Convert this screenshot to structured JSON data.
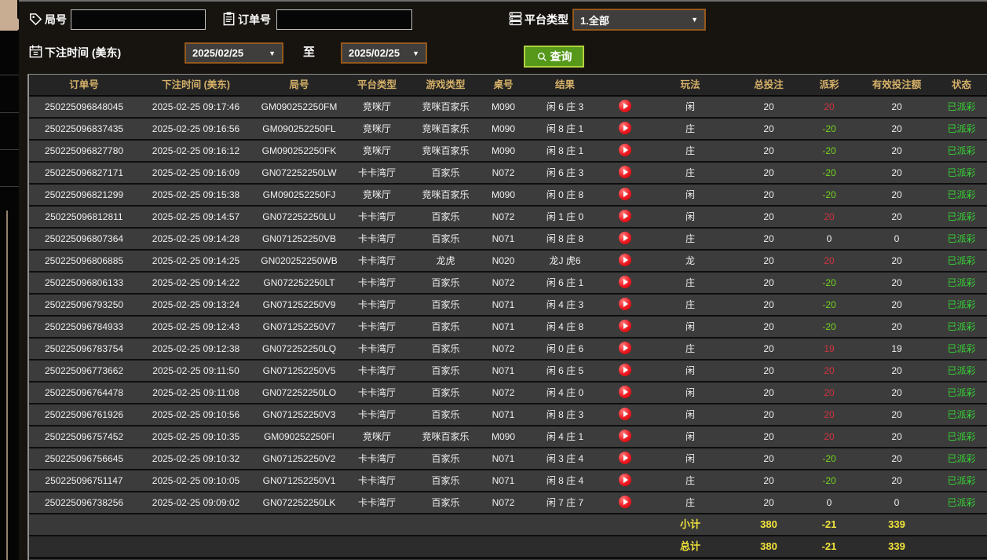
{
  "filters": {
    "round_label": "局号",
    "round_value": "",
    "order_label": "订单号",
    "order_value": "",
    "platform_label": "平台类型",
    "platform_value": "1.全部",
    "bet_time_label": "下注时间 (美东)",
    "date_from": "2025/02/25",
    "date_to": "2025/02/25",
    "to_label": "至",
    "query_label": "查询"
  },
  "colors": {
    "accent_gold": "#d5b169",
    "query_button_green": "#55981a",
    "query_button_border": "#b3d13e",
    "select_border_orange": "#94581d",
    "payout_positive_red": "#cf3440",
    "payout_negative_green": "#72d41f",
    "status_green": "#35d435",
    "summary_yellow": "#f2e33c",
    "tab_tan": "#c9ad92"
  },
  "table": {
    "columns": [
      "订单号",
      "下注时间 (美东)",
      "局号",
      "平台类型",
      "游戏类型",
      "桌号",
      "结果",
      "",
      "玩法",
      "总投注",
      "派彩",
      "有效投注额",
      "状态"
    ],
    "rows": [
      {
        "order": "250225096848045",
        "time": "2025-02-25 09:17:46",
        "round": "GM090252250FM",
        "platform": "竞咪厅",
        "game": "竞咪百家乐",
        "table_no": "M090",
        "result": "闲 6 庄 3",
        "playtype": "闲",
        "total_bet": "20",
        "payout": "20",
        "valid_bet": "20",
        "status": "已派彩"
      },
      {
        "order": "250225096837435",
        "time": "2025-02-25 09:16:56",
        "round": "GM090252250FL",
        "platform": "竞咪厅",
        "game": "竞咪百家乐",
        "table_no": "M090",
        "result": "闲 8 庄 1",
        "playtype": "庄",
        "total_bet": "20",
        "payout": "-20",
        "valid_bet": "20",
        "status": "已派彩"
      },
      {
        "order": "250225096827780",
        "time": "2025-02-25 09:16:12",
        "round": "GM090252250FK",
        "platform": "竞咪厅",
        "game": "竞咪百家乐",
        "table_no": "M090",
        "result": "闲 8 庄 1",
        "playtype": "庄",
        "total_bet": "20",
        "payout": "-20",
        "valid_bet": "20",
        "status": "已派彩"
      },
      {
        "order": "250225096827171",
        "time": "2025-02-25 09:16:09",
        "round": "GN072252250LW",
        "platform": "卡卡湾厅",
        "game": "百家乐",
        "table_no": "N072",
        "result": "闲 6 庄 3",
        "playtype": "庄",
        "total_bet": "20",
        "payout": "-20",
        "valid_bet": "20",
        "status": "已派彩"
      },
      {
        "order": "250225096821299",
        "time": "2025-02-25 09:15:38",
        "round": "GM090252250FJ",
        "platform": "竞咪厅",
        "game": "竞咪百家乐",
        "table_no": "M090",
        "result": "闲 0 庄 8",
        "playtype": "闲",
        "total_bet": "20",
        "payout": "-20",
        "valid_bet": "20",
        "status": "已派彩"
      },
      {
        "order": "250225096812811",
        "time": "2025-02-25 09:14:57",
        "round": "GN072252250LU",
        "platform": "卡卡湾厅",
        "game": "百家乐",
        "table_no": "N072",
        "result": "闲 1 庄 0",
        "playtype": "闲",
        "total_bet": "20",
        "payout": "20",
        "valid_bet": "20",
        "status": "已派彩"
      },
      {
        "order": "250225096807364",
        "time": "2025-02-25 09:14:28",
        "round": "GN071252250VB",
        "platform": "卡卡湾厅",
        "game": "百家乐",
        "table_no": "N071",
        "result": "闲 8 庄 8",
        "playtype": "庄",
        "total_bet": "20",
        "payout": "0",
        "valid_bet": "0",
        "status": "已派彩"
      },
      {
        "order": "250225096806885",
        "time": "2025-02-25 09:14:25",
        "round": "GN020252250WB",
        "platform": "卡卡湾厅",
        "game": "龙虎",
        "table_no": "N020",
        "result": "龙J 虎6",
        "playtype": "龙",
        "total_bet": "20",
        "payout": "20",
        "valid_bet": "20",
        "status": "已派彩"
      },
      {
        "order": "250225096806133",
        "time": "2025-02-25 09:14:22",
        "round": "GN072252250LT",
        "platform": "卡卡湾厅",
        "game": "百家乐",
        "table_no": "N072",
        "result": "闲 6 庄 1",
        "playtype": "庄",
        "total_bet": "20",
        "payout": "-20",
        "valid_bet": "20",
        "status": "已派彩"
      },
      {
        "order": "250225096793250",
        "time": "2025-02-25 09:13:24",
        "round": "GN071252250V9",
        "platform": "卡卡湾厅",
        "game": "百家乐",
        "table_no": "N071",
        "result": "闲 4 庄 3",
        "playtype": "庄",
        "total_bet": "20",
        "payout": "-20",
        "valid_bet": "20",
        "status": "已派彩"
      },
      {
        "order": "250225096784933",
        "time": "2025-02-25 09:12:43",
        "round": "GN071252250V7",
        "platform": "卡卡湾厅",
        "game": "百家乐",
        "table_no": "N071",
        "result": "闲 4 庄 8",
        "playtype": "闲",
        "total_bet": "20",
        "payout": "-20",
        "valid_bet": "20",
        "status": "已派彩"
      },
      {
        "order": "250225096783754",
        "time": "2025-02-25 09:12:38",
        "round": "GN072252250LQ",
        "platform": "卡卡湾厅",
        "game": "百家乐",
        "table_no": "N072",
        "result": "闲 0 庄 6",
        "playtype": "庄",
        "total_bet": "20",
        "payout": "19",
        "valid_bet": "19",
        "status": "已派彩"
      },
      {
        "order": "250225096773662",
        "time": "2025-02-25 09:11:50",
        "round": "GN071252250V5",
        "platform": "卡卡湾厅",
        "game": "百家乐",
        "table_no": "N071",
        "result": "闲 6 庄 5",
        "playtype": "闲",
        "total_bet": "20",
        "payout": "20",
        "valid_bet": "20",
        "status": "已派彩"
      },
      {
        "order": "250225096764478",
        "time": "2025-02-25 09:11:08",
        "round": "GN072252250LO",
        "platform": "卡卡湾厅",
        "game": "百家乐",
        "table_no": "N072",
        "result": "闲 4 庄 0",
        "playtype": "闲",
        "total_bet": "20",
        "payout": "20",
        "valid_bet": "20",
        "status": "已派彩"
      },
      {
        "order": "250225096761926",
        "time": "2025-02-25 09:10:56",
        "round": "GN071252250V3",
        "platform": "卡卡湾厅",
        "game": "百家乐",
        "table_no": "N071",
        "result": "闲 8 庄 3",
        "playtype": "闲",
        "total_bet": "20",
        "payout": "20",
        "valid_bet": "20",
        "status": "已派彩"
      },
      {
        "order": "250225096757452",
        "time": "2025-02-25 09:10:35",
        "round": "GM090252250FI",
        "platform": "竞咪厅",
        "game": "竞咪百家乐",
        "table_no": "M090",
        "result": "闲 4 庄 1",
        "playtype": "闲",
        "total_bet": "20",
        "payout": "20",
        "valid_bet": "20",
        "status": "已派彩"
      },
      {
        "order": "250225096756645",
        "time": "2025-02-25 09:10:32",
        "round": "GN071252250V2",
        "platform": "卡卡湾厅",
        "game": "百家乐",
        "table_no": "N071",
        "result": "闲 3 庄 4",
        "playtype": "闲",
        "total_bet": "20",
        "payout": "-20",
        "valid_bet": "20",
        "status": "已派彩"
      },
      {
        "order": "250225096751147",
        "time": "2025-02-25 09:10:05",
        "round": "GN071252250V1",
        "platform": "卡卡湾厅",
        "game": "百家乐",
        "table_no": "N071",
        "result": "闲 8 庄 4",
        "playtype": "庄",
        "total_bet": "20",
        "payout": "-20",
        "valid_bet": "20",
        "status": "已派彩"
      },
      {
        "order": "250225096738256",
        "time": "2025-02-25 09:09:02",
        "round": "GN072252250LK",
        "platform": "卡卡湾厅",
        "game": "百家乐",
        "table_no": "N072",
        "result": "闲 7 庄 7",
        "playtype": "庄",
        "total_bet": "20",
        "payout": "0",
        "valid_bet": "0",
        "status": "已派彩"
      }
    ],
    "subtotal": {
      "label": "小计",
      "total_bet": "380",
      "payout": "-21",
      "valid_bet": "339"
    },
    "total": {
      "label": "总计",
      "total_bet": "380",
      "payout": "-21",
      "valid_bet": "339"
    }
  }
}
